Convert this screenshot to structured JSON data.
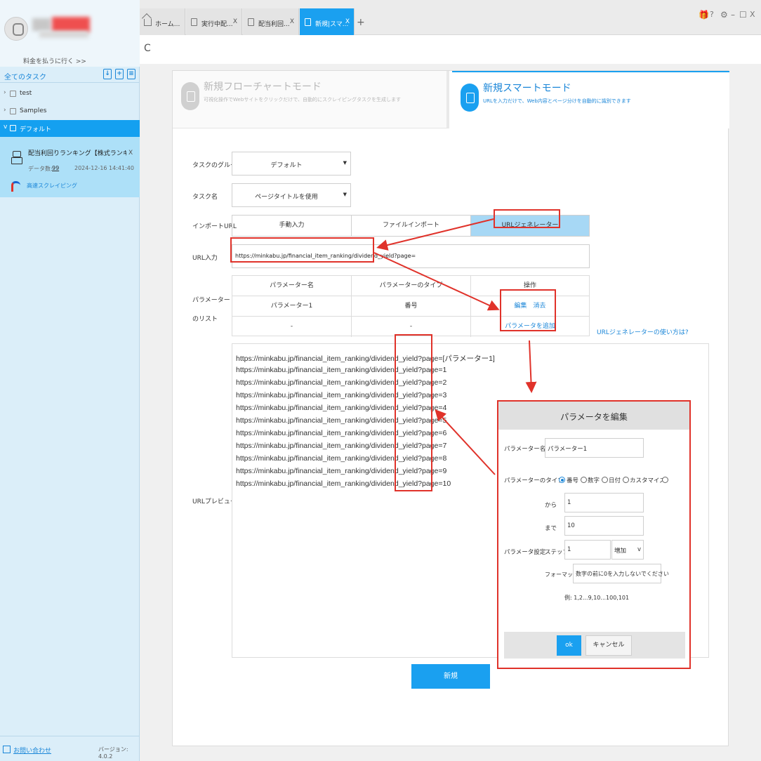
{
  "sidebar": {
    "upgrade_link": "料金を払うに行く >>",
    "all_tasks": "全てのタスク",
    "header_icons": [
      "import-icon",
      "add-task-icon",
      "list-icon"
    ],
    "tree": [
      {
        "label": "test",
        "arrow": "›"
      },
      {
        "label": "Samples",
        "arrow": "›"
      },
      {
        "label": "デフォルト",
        "arrow": "v"
      }
    ],
    "task": {
      "title": "配当利回りランキング【株式ランキング】...",
      "close": "X",
      "count_label": "データ数:",
      "count": "99",
      "date": "2024-12-16 14:41:40",
      "fast_label": "高速スクレイピング"
    },
    "contact": "お問い合わせ",
    "version": "バージョン: 4.0.2"
  },
  "tabs": [
    {
      "label": "ホーム...",
      "icon": "home-icon",
      "close": ""
    },
    {
      "label": "実行中配...",
      "icon": "doc-icon",
      "close": "X"
    },
    {
      "label": "配当利回...",
      "icon": "doc-icon",
      "close": "X"
    },
    {
      "label": "新規|スマ...",
      "icon": "doc-icon",
      "close": "X",
      "active": true
    }
  ],
  "tab_add": "+",
  "window_controls": [
    "gift-icon",
    "help-icon",
    "settings-icon",
    "minimize-icon",
    "maximize-icon",
    "close-icon"
  ],
  "window_glyphs": [
    "🎁",
    "?",
    "⚙",
    "–",
    "☐",
    "X"
  ],
  "toolbar": {
    "reload": "C"
  },
  "modes": {
    "flow": {
      "title": "新規フローチャートモード",
      "desc": "可視化操作でWebサイトをクリックだけで、自動的にスクレイピングタスクを生成します"
    },
    "smart": {
      "title": "新規スマートモード",
      "desc": "URLを入力だけで、Web内容とページ分けを自動的に識別できます"
    }
  },
  "form": {
    "group_label": "タスクのグループ",
    "group_value": "デフォルト",
    "name_label": "タスク名",
    "name_value": "ページタイトルを使用",
    "import_label": "インポートURL",
    "import_options": [
      "手動入力",
      "ファイルインポート",
      "URLジェネレーター"
    ],
    "url_label": "URL入力",
    "url_value": "https://minkabu.jp/financial_item_ranking/dividend_yield?page=",
    "param_list_label": "パラメーターのリスト",
    "param_table": {
      "headers": [
        "パラメーター名",
        "パラメーターのタイプ",
        "操作"
      ],
      "rows": [
        [
          "パラメーター1",
          "番号",
          ""
        ],
        [
          "-",
          "-",
          ""
        ]
      ],
      "edit": "編集",
      "delete": "消去",
      "add": "パラメータを追加"
    },
    "url_help": "URLジェネレーターの使い方は?",
    "preview_label": "URLプレビュー",
    "preview_lines": [
      "https://minkabu.jp/financial_item_ranking/dividend_yield?page=[パラメーター1]",
      "https://minkabu.jp/financial_item_ranking/dividend_yield?page=1",
      "https://minkabu.jp/financial_item_ranking/dividend_yield?page=2",
      "https://minkabu.jp/financial_item_ranking/dividend_yield?page=3",
      "https://minkabu.jp/financial_item_ranking/dividend_yield?page=4",
      "https://minkabu.jp/financial_item_ranking/dividend_yield?page=5",
      "https://minkabu.jp/financial_item_ranking/dividend_yield?page=6",
      "https://minkabu.jp/financial_item_ranking/dividend_yield?page=7",
      "https://minkabu.jp/financial_item_ranking/dividend_yield?page=8",
      "https://minkabu.jp/financial_item_ranking/dividend_yield?page=9",
      "https://minkabu.jp/financial_item_ranking/dividend_yield?page=10"
    ],
    "create": "新規"
  },
  "dialog": {
    "title": "パラメータを編集",
    "name_label": "パラメーター名",
    "name_value": "パラメーター1",
    "type_label": "パラメーターのタイプ",
    "type_options": [
      "番号",
      "数字",
      "日付",
      "カスタマイズ"
    ],
    "type_selected": "番号",
    "from_label": "から",
    "from_value": "1",
    "to_label": "まで",
    "to_value": "10",
    "setting_label": "パラメータ設定",
    "step_label": "ステップ",
    "step_value": "1",
    "step_mode": "増加",
    "format_label": "フォーマット",
    "format_value": "数字の前に0を入力しないでください",
    "example": "例: 1,2...9,10...100,101",
    "ok": "ok",
    "cancel": "キャンセル"
  },
  "colors": {
    "accent": "#1aa0f0",
    "annotation": "#e0322a",
    "sidebar_bg": "#dbeef9",
    "task_selected": "#ade0f8"
  }
}
